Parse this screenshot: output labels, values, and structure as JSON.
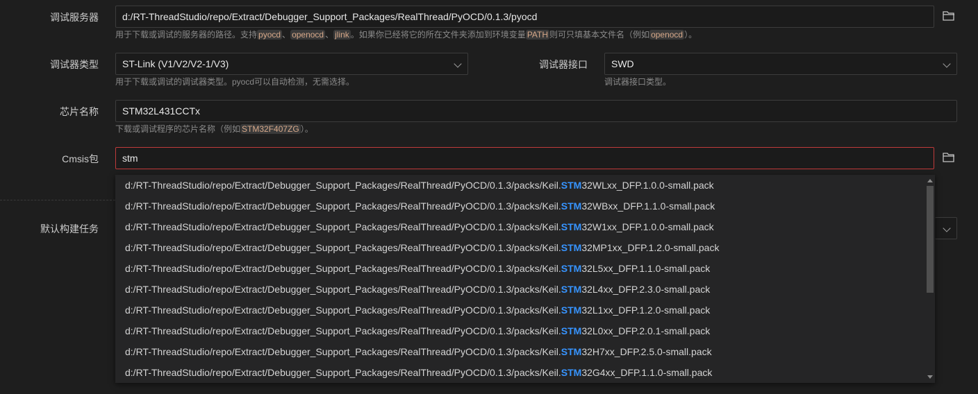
{
  "server": {
    "label": "调试服务器",
    "value": "d:/RT-ThreadStudio/repo/Extract/Debugger_Support_Packages/RealThread/PyOCD/0.1.3/pyocd",
    "help_a": "用于下载或调试的服务器的路径。支持",
    "code1": "pyocd",
    "sep1": "、",
    "code2": "openocd",
    "sep2": "、",
    "code3": "jlink",
    "help_b": "。如果你已经将它的所在文件夹添加到环境变量",
    "code4": "PATH",
    "help_c": "则可只填基本文件名（例如",
    "code5": "openocd",
    "help_d": "）。"
  },
  "debugger_type": {
    "label": "调试器类型",
    "value": "ST-Link (V1/V2/V2-1/V3)",
    "help": "用于下载或调试的调试器类型。pyocd可以自动检测，无需选择。"
  },
  "debugger_port": {
    "label": "调试器接口",
    "value": "SWD",
    "help": "调试器接口类型。"
  },
  "chip": {
    "label": "芯片名称",
    "value": "STM32L431CCTx",
    "help_a": "下载或调试程序的芯片名称（例如",
    "code": "STM32F407ZG",
    "help_b": "）。"
  },
  "cmsis": {
    "label": "Cmsis包",
    "value": "stm"
  },
  "build_task": {
    "label": "默认构建任务"
  },
  "suggestions": {
    "prefix": "d:/RT-ThreadStudio/repo/Extract/Debugger_Support_Packages/RealThread/PyOCD/0.1.3/packs/Keil.",
    "match": "STM",
    "items": [
      "32WLxx_DFP.1.0.0-small.pack",
      "32WBxx_DFP.1.1.0-small.pack",
      "32W1xx_DFP.1.0.0-small.pack",
      "32MP1xx_DFP.1.2.0-small.pack",
      "32L5xx_DFP.1.1.0-small.pack",
      "32L4xx_DFP.2.3.0-small.pack",
      "32L1xx_DFP.1.2.0-small.pack",
      "32L0xx_DFP.2.0.1-small.pack",
      "32H7xx_DFP.2.5.0-small.pack",
      "32G4xx_DFP.1.1.0-small.pack"
    ]
  },
  "icons": {
    "folder": "folder-open-icon",
    "chevron": "chevron-down-icon"
  },
  "colors": {
    "background": "#1e1e1e",
    "error_border": "#c03b3b",
    "match_highlight": "#3794ff"
  }
}
